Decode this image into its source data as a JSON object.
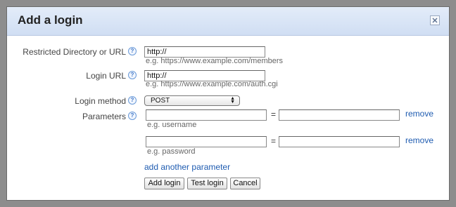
{
  "dialog": {
    "title": "Add a login",
    "close_glyph": "×"
  },
  "restricted": {
    "label": "Restricted Directory or URL",
    "value": "http://",
    "hint": "e.g. https://www.example.com/members"
  },
  "login_url": {
    "label": "Login URL",
    "value": "http://",
    "hint": "e.g. https://www.example.com/auth.cgi"
  },
  "login_method": {
    "label": "Login method",
    "selected": "POST"
  },
  "parameters": {
    "label": "Parameters",
    "rows": [
      {
        "name": "",
        "value": "",
        "equals": "=",
        "remove": "remove",
        "hint": "e.g. username"
      },
      {
        "name": "",
        "value": "",
        "equals": "=",
        "remove": "remove",
        "hint": "e.g. password"
      }
    ],
    "add_link": "add another parameter"
  },
  "help_glyph": "?",
  "buttons": {
    "add": "Add login",
    "test": "Test login",
    "cancel": "Cancel"
  },
  "icons": [
    "close-icon",
    "help-icon",
    "select-arrows-icon"
  ],
  "colors": {
    "link": "#1e5bb0",
    "titlebar": "#d8e4f6",
    "help": "#3c74c6"
  }
}
